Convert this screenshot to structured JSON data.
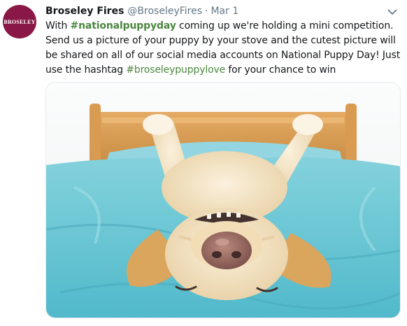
{
  "author": {
    "avatar_text": "BROSELEY",
    "display_name": "Broseley Fires",
    "handle": "@BroseleyFires",
    "separator": "·",
    "date": "Mar 1"
  },
  "tweet": {
    "text_1": "With ",
    "hashtag_1": "#nationalpuppyday",
    "text_2": " coming up we're holding a mini competition. Send us a picture of your puppy by your stove and the cutest picture will be shared on all of our social media accounts on National Puppy Day! Just use the hashtag ",
    "hashtag_2": "#broseleypuppylove",
    "text_3": " for your chance to win"
  },
  "media": {
    "image": "dog-on-bed-photo"
  },
  "colors": {
    "brand": "#8a1846",
    "hashtag": "#4c8740",
    "secondary_text": "#657786"
  },
  "icons": {
    "menu": "chevron-down-icon"
  }
}
